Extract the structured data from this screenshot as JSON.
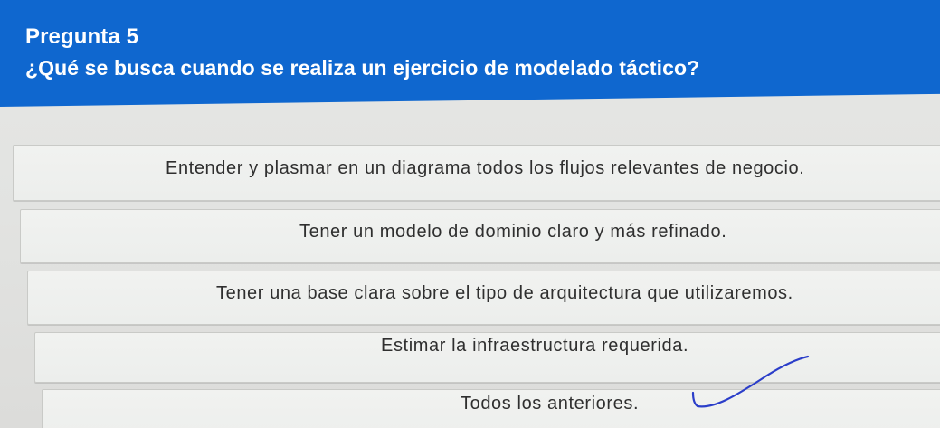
{
  "question": {
    "number": "Pregunta 5",
    "text": "¿Qué se busca cuando se realiza un ejercicio de modelado táctico?",
    "header_color": "#0f67cf"
  },
  "options": [
    {
      "label": "Entender y plasmar en un diagrama todos los flujos relevantes de negocio."
    },
    {
      "label": "Tener un modelo de dominio claro y más refinado."
    },
    {
      "label": "Tener una base clara sobre el tipo de arquitectura que utilizaremos."
    },
    {
      "label": "Estimar la infraestructura requerida."
    },
    {
      "label": "Todos los anteriores."
    }
  ],
  "annotation": {
    "icon": "hand-drawn-check-icon",
    "color": "#2b3ec9"
  }
}
